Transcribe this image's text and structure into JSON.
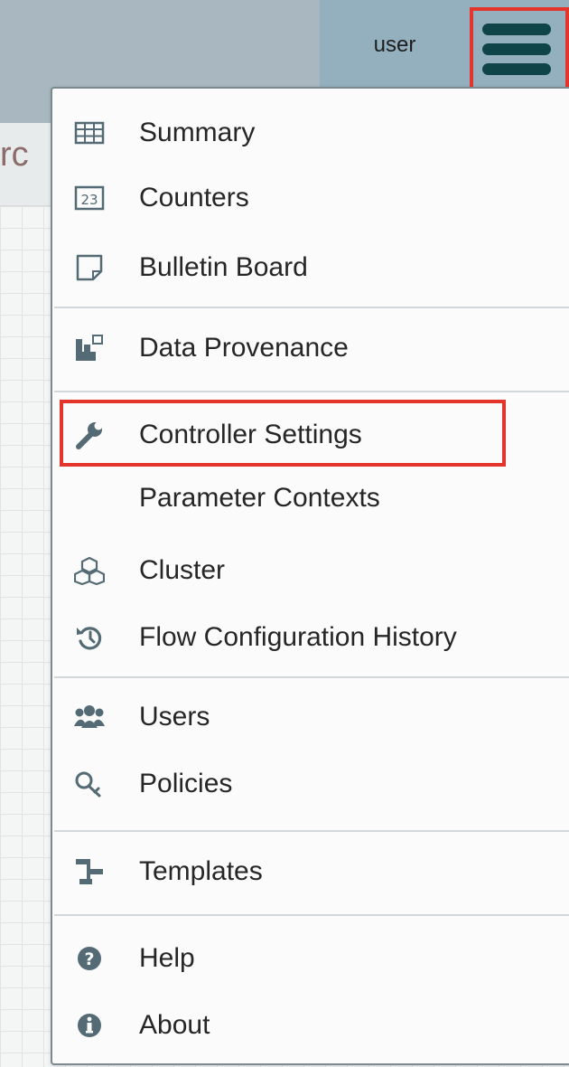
{
  "header": {
    "user": "user"
  },
  "toolbar": {
    "breadcrumb": "rc"
  },
  "menu": {
    "items": [
      {
        "label": "Summary",
        "icon": "table-icon"
      },
      {
        "label": "Counters",
        "icon": "counter-icon"
      },
      {
        "label": "Bulletin Board",
        "icon": "sticky-note-icon"
      },
      {
        "label": "Data Provenance",
        "icon": "provenance-icon"
      },
      {
        "label": "Controller Settings",
        "icon": "wrench-icon"
      },
      {
        "label": "Parameter Contexts",
        "icon": ""
      },
      {
        "label": "Cluster",
        "icon": "cubes-icon"
      },
      {
        "label": "Flow Configuration History",
        "icon": "history-icon"
      },
      {
        "label": "Users",
        "icon": "users-icon"
      },
      {
        "label": "Policies",
        "icon": "key-icon"
      },
      {
        "label": "Templates",
        "icon": "templates-icon"
      },
      {
        "label": "Help",
        "icon": "help-icon"
      },
      {
        "label": "About",
        "icon": "info-icon"
      }
    ]
  },
  "colors": {
    "icon": "#546b75",
    "highlight": "#e3352b",
    "hamburger": "#0f4449"
  }
}
